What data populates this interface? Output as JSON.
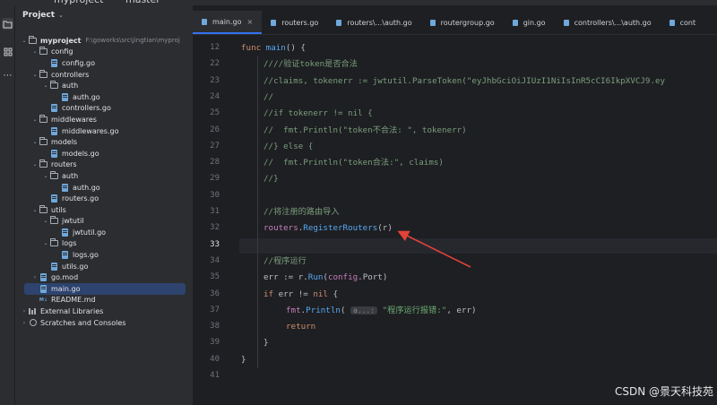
{
  "titlebar": {
    "project_name": "myproject",
    "branch": "master"
  },
  "project_panel": {
    "title": "Project",
    "tree": [
      {
        "label": "myproject",
        "path": "F:\\goworks\\src\\jingtian\\myproj",
        "type": "folder",
        "depth": 0,
        "expanded": true,
        "bold": true
      },
      {
        "label": "config",
        "type": "folder",
        "depth": 1,
        "expanded": true
      },
      {
        "label": "config.go",
        "type": "go",
        "depth": 2
      },
      {
        "label": "controllers",
        "type": "folder",
        "depth": 1,
        "expanded": true
      },
      {
        "label": "auth",
        "type": "folder",
        "depth": 2,
        "expanded": true
      },
      {
        "label": "auth.go",
        "type": "go",
        "depth": 3
      },
      {
        "label": "controllers.go",
        "type": "go",
        "depth": 2
      },
      {
        "label": "middlewares",
        "type": "folder",
        "depth": 1,
        "expanded": true
      },
      {
        "label": "middlewares.go",
        "type": "go",
        "depth": 2
      },
      {
        "label": "models",
        "type": "folder",
        "depth": 1,
        "expanded": true
      },
      {
        "label": "models.go",
        "type": "go",
        "depth": 2
      },
      {
        "label": "routers",
        "type": "folder",
        "depth": 1,
        "expanded": true
      },
      {
        "label": "auth",
        "type": "folder",
        "depth": 2,
        "expanded": true
      },
      {
        "label": "auth.go",
        "type": "go",
        "depth": 3
      },
      {
        "label": "routers.go",
        "type": "go",
        "depth": 2
      },
      {
        "label": "utils",
        "type": "folder",
        "depth": 1,
        "expanded": true
      },
      {
        "label": "jwtutil",
        "type": "folder",
        "depth": 2,
        "expanded": true
      },
      {
        "label": "jwtutil.go",
        "type": "go",
        "depth": 3
      },
      {
        "label": "logs",
        "type": "folder",
        "depth": 2,
        "expanded": true
      },
      {
        "label": "logs.go",
        "type": "go",
        "depth": 3
      },
      {
        "label": "utils.go",
        "type": "go",
        "depth": 2
      },
      {
        "label": "go.mod",
        "type": "go",
        "depth": 1,
        "expanded": false
      },
      {
        "label": "main.go",
        "type": "go",
        "depth": 1,
        "selected": true
      },
      {
        "label": "README.md",
        "type": "md",
        "depth": 1
      },
      {
        "label": "External Libraries",
        "type": "lib",
        "depth": 0,
        "expanded": false
      },
      {
        "label": "Scratches and Consoles",
        "type": "scratch",
        "depth": 0,
        "expanded": false
      }
    ]
  },
  "tabs": [
    {
      "label": "main.go",
      "active": true,
      "closable": true
    },
    {
      "label": "routers.go"
    },
    {
      "label": "routers\\...\\auth.go"
    },
    {
      "label": "routergroup.go"
    },
    {
      "label": "gin.go"
    },
    {
      "label": "controllers\\...\\auth.go"
    },
    {
      "label": "cont"
    }
  ],
  "editor": {
    "current_line": "33",
    "lines": [
      {
        "num": "12",
        "tokens": [
          [
            "kw",
            "func "
          ],
          [
            "fn",
            "main"
          ],
          [
            "pl",
            "() {"
          ]
        ]
      },
      {
        "num": "22",
        "indent": 1,
        "tokens": [
          [
            "cm",
            "////验证token是否合法"
          ]
        ]
      },
      {
        "num": "23",
        "indent": 1,
        "tokens": [
          [
            "cm",
            "//claims, tokenerr := jwtutil.ParseToken(\"eyJhbGciOiJIUzI1NiIsInR5cCI6IkpXVCJ9.ey"
          ]
        ]
      },
      {
        "num": "24",
        "indent": 1,
        "tokens": [
          [
            "cm",
            "//"
          ]
        ]
      },
      {
        "num": "25",
        "indent": 1,
        "tokens": [
          [
            "cm",
            "//if tokenerr != nil {"
          ]
        ]
      },
      {
        "num": "26",
        "indent": 1,
        "tokens": [
          [
            "cm",
            "//  fmt.Println(\"token不合法: \", tokenerr)"
          ]
        ]
      },
      {
        "num": "27",
        "indent": 1,
        "tokens": [
          [
            "cm",
            "//} else {"
          ]
        ]
      },
      {
        "num": "28",
        "indent": 1,
        "tokens": [
          [
            "cm",
            "//  fmt.Println(\"token合法:\", claims)"
          ]
        ]
      },
      {
        "num": "29",
        "indent": 1,
        "tokens": [
          [
            "cm",
            "//}"
          ]
        ]
      },
      {
        "num": "30",
        "tokens": []
      },
      {
        "num": "31",
        "indent": 1,
        "tokens": [
          [
            "cm",
            "//将注册的路由导入"
          ]
        ]
      },
      {
        "num": "32",
        "indent": 1,
        "tokens": [
          [
            "pk",
            "routers"
          ],
          [
            "pl",
            "."
          ],
          [
            "fn",
            "RegisterRouters"
          ],
          [
            "pl",
            "(r)"
          ]
        ]
      },
      {
        "num": "33",
        "tokens": [],
        "current": true
      },
      {
        "num": "34",
        "indent": 1,
        "tokens": [
          [
            "cm",
            "//程序运行"
          ]
        ]
      },
      {
        "num": "35",
        "indent": 1,
        "tokens": [
          [
            "pl",
            "err := r."
          ],
          [
            "fn",
            "Run"
          ],
          [
            "pl",
            "("
          ],
          [
            "pk",
            "config"
          ],
          [
            "pl",
            ".Port)"
          ]
        ]
      },
      {
        "num": "36",
        "indent": 1,
        "tokens": [
          [
            "kw",
            "if "
          ],
          [
            "pl",
            "err != "
          ],
          [
            "kw",
            "nil"
          ],
          [
            "pl",
            " {"
          ]
        ]
      },
      {
        "num": "37",
        "indent": 2,
        "tokens": [
          [
            "pk",
            "fmt"
          ],
          [
            "pl",
            "."
          ],
          [
            "fn",
            "Println"
          ],
          [
            "pl",
            "( "
          ],
          [
            "hint",
            "a...:"
          ],
          [
            "st",
            " \"程序运行报错:\""
          ],
          [
            "pl",
            ", err)"
          ]
        ]
      },
      {
        "num": "38",
        "indent": 2,
        "tokens": [
          [
            "kw",
            "return"
          ]
        ]
      },
      {
        "num": "39",
        "indent": 1,
        "tokens": [
          [
            "pl",
            "}"
          ]
        ]
      },
      {
        "num": "40",
        "tokens": [
          [
            "pl",
            "}"
          ]
        ]
      },
      {
        "num": "41",
        "tokens": []
      }
    ]
  },
  "watermark": "CSDN @景天科技苑",
  "colors": {
    "arrow": "#e0423a",
    "selection": "#2e436e",
    "active_tab_underline": "#3574f0"
  }
}
